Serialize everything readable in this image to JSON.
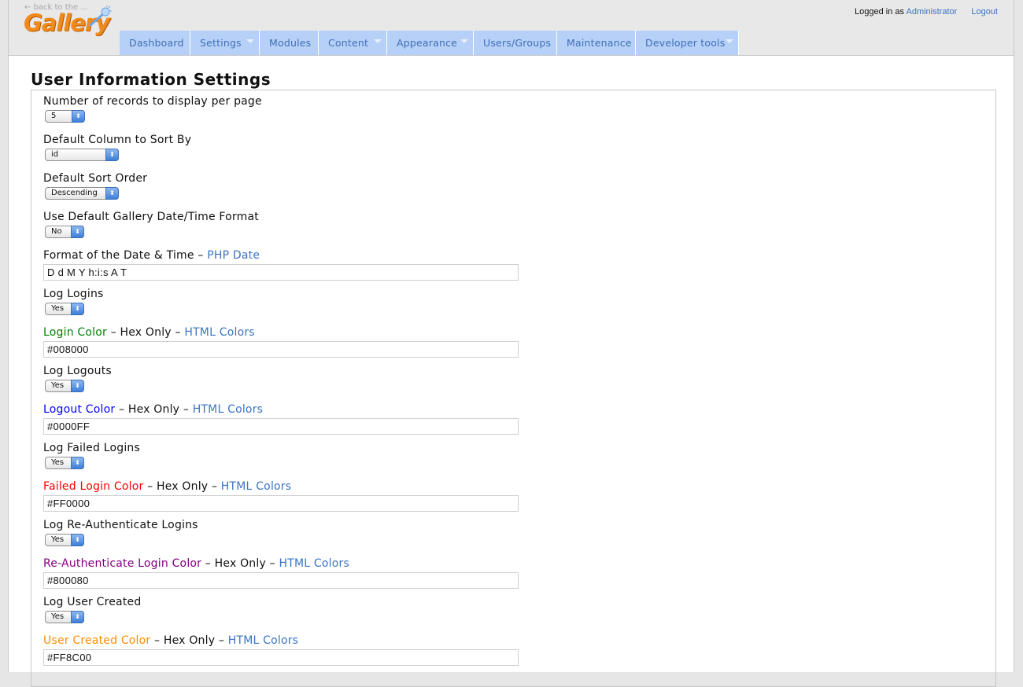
{
  "header": {
    "back_link": "← back to the ...",
    "logo_text": "Gallery",
    "logged_in_as": "Logged in as",
    "user_name": "Administrator",
    "logout": "Logout"
  },
  "nav": {
    "items": [
      {
        "label": "Dashboard"
      },
      {
        "label": "Settings"
      },
      {
        "label": "Modules"
      },
      {
        "label": "Content"
      },
      {
        "label": "Appearance"
      },
      {
        "label": "Users/Groups"
      },
      {
        "label": "Maintenance"
      },
      {
        "label": "Developer tools"
      }
    ]
  },
  "page": {
    "title": "User Information Settings"
  },
  "form": {
    "records_per_page": {
      "label": "Number of records to display per page",
      "value": "5"
    },
    "sort_column": {
      "label": "Default Column to Sort By",
      "value": "id"
    },
    "sort_order": {
      "label": "Default Sort Order",
      "value": "Descending"
    },
    "default_date_format": {
      "label": "Use Default Gallery Date/Time Format",
      "value": "No"
    },
    "date_format": {
      "label": "Format of the Date & Time",
      "link": "PHP Date",
      "value": "D d M Y h:i:s A T"
    },
    "log_logins": {
      "label": "Log Logins",
      "value": "Yes"
    },
    "login_color": {
      "label": "Login Color",
      "color": "#008000",
      "hex_only": "Hex Only",
      "link": "HTML Colors",
      "value": "#008000"
    },
    "log_logouts": {
      "label": "Log Logouts",
      "value": "Yes"
    },
    "logout_color": {
      "label": "Logout Color",
      "color": "#0000FF",
      "hex_only": "Hex Only",
      "link": "HTML Colors",
      "value": "#0000FF"
    },
    "log_failed": {
      "label": "Log Failed Logins",
      "value": "Yes"
    },
    "failed_color": {
      "label": "Failed Login Color",
      "color": "#FF0000",
      "hex_only": "Hex Only",
      "link": "HTML Colors",
      "value": "#FF0000"
    },
    "log_reauth": {
      "label": "Log Re-Authenticate Logins",
      "value": "Yes"
    },
    "reauth_color": {
      "label": "Re-Authenticate Login Color",
      "color": "#800080",
      "hex_only": "Hex Only",
      "link": "HTML Colors",
      "value": "#800080"
    },
    "log_user_created": {
      "label": "Log User Created",
      "value": "Yes"
    },
    "user_created_color": {
      "label": "User Created Color",
      "color": "#FF8C00",
      "hex_only": "Hex Only",
      "link": "HTML Colors",
      "value": "#FF8C00"
    }
  },
  "dash": "–",
  "stepper_glyph": "⬍",
  "colors": {
    "nav_bg": "#b7d0f7",
    "link": "#3a74c4",
    "logo": "#f08a1c"
  }
}
